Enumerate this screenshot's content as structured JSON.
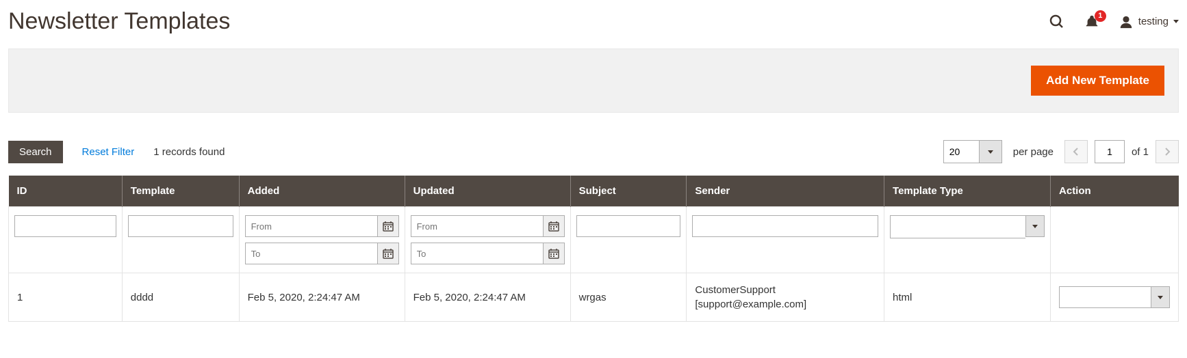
{
  "header": {
    "title": "Newsletter Templates",
    "notification_count": "1",
    "user_name": "testing"
  },
  "action_bar": {
    "add_new_label": "Add New Template"
  },
  "grid": {
    "search_label": "Search",
    "reset_label": "Reset Filter",
    "records_found": "1 records found",
    "page_size": "20",
    "per_page_label": "per page",
    "current_page": "1",
    "of_label": "of",
    "total_pages": "1",
    "columns": {
      "id": "ID",
      "template": "Template",
      "added": "Added",
      "updated": "Updated",
      "subject": "Subject",
      "sender": "Sender",
      "type": "Template Type",
      "action": "Action"
    },
    "filters": {
      "date_from_placeholder": "From",
      "date_to_placeholder": "To"
    },
    "rows": [
      {
        "id": "1",
        "template": "dddd",
        "added": "Feb 5, 2020, 2:24:47 AM",
        "updated": "Feb 5, 2020, 2:24:47 AM",
        "subject": "wrgas",
        "sender_name": "CustomerSupport",
        "sender_email": "[support@example.com]",
        "type": "html"
      }
    ]
  }
}
